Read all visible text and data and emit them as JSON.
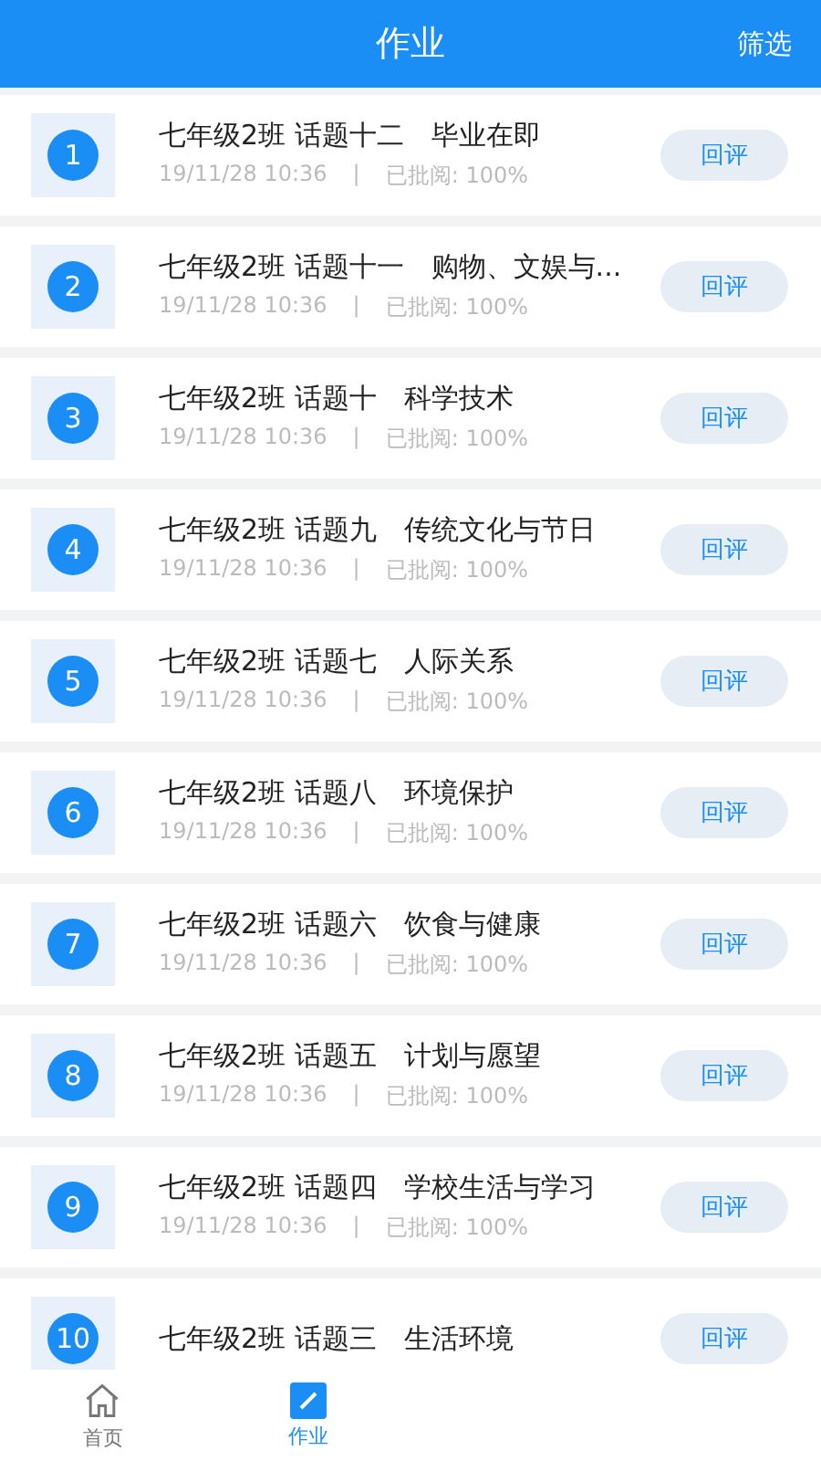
{
  "header": {
    "title": "作业",
    "action": "筛选"
  },
  "assignments": [
    {
      "index": "1",
      "title": "七年级2班 话题十二　毕业在即",
      "date": "19/11/28 10:36",
      "separator": "|",
      "status": "已批阅:  100%",
      "button": "回评"
    },
    {
      "index": "2",
      "title": "七年级2班 话题十一　购物、文娱与...",
      "date": "19/11/28 10:36",
      "separator": "|",
      "status": "已批阅:  100%",
      "button": "回评"
    },
    {
      "index": "3",
      "title": "七年级2班 话题十　科学技术",
      "date": "19/11/28 10:36",
      "separator": "|",
      "status": "已批阅:  100%",
      "button": "回评"
    },
    {
      "index": "4",
      "title": "七年级2班 话题九　传统文化与节日",
      "date": "19/11/28 10:36",
      "separator": "|",
      "status": "已批阅:  100%",
      "button": "回评"
    },
    {
      "index": "5",
      "title": "七年级2班 话题七　人际关系",
      "date": "19/11/28 10:36",
      "separator": "|",
      "status": "已批阅:  100%",
      "button": "回评"
    },
    {
      "index": "6",
      "title": "七年级2班 话题八　环境保护",
      "date": "19/11/28 10:36",
      "separator": "|",
      "status": "已批阅:  100%",
      "button": "回评"
    },
    {
      "index": "7",
      "title": "七年级2班 话题六　饮食与健康",
      "date": "19/11/28 10:36",
      "separator": "|",
      "status": "已批阅:  100%",
      "button": "回评"
    },
    {
      "index": "8",
      "title": "七年级2班 话题五　计划与愿望",
      "date": "19/11/28 10:36",
      "separator": "|",
      "status": "已批阅:  100%",
      "button": "回评"
    },
    {
      "index": "9",
      "title": "七年级2班 话题四　学校生活与学习",
      "date": "19/11/28 10:36",
      "separator": "|",
      "status": "已批阅:  100%",
      "button": "回评"
    },
    {
      "index": "10",
      "title": "七年级2班 话题三　生活环境",
      "button": "回评"
    }
  ],
  "tabs": [
    {
      "label": "首页",
      "kind": "home",
      "selected": false
    },
    {
      "label": "作业",
      "kind": "homework",
      "selected": true
    }
  ]
}
